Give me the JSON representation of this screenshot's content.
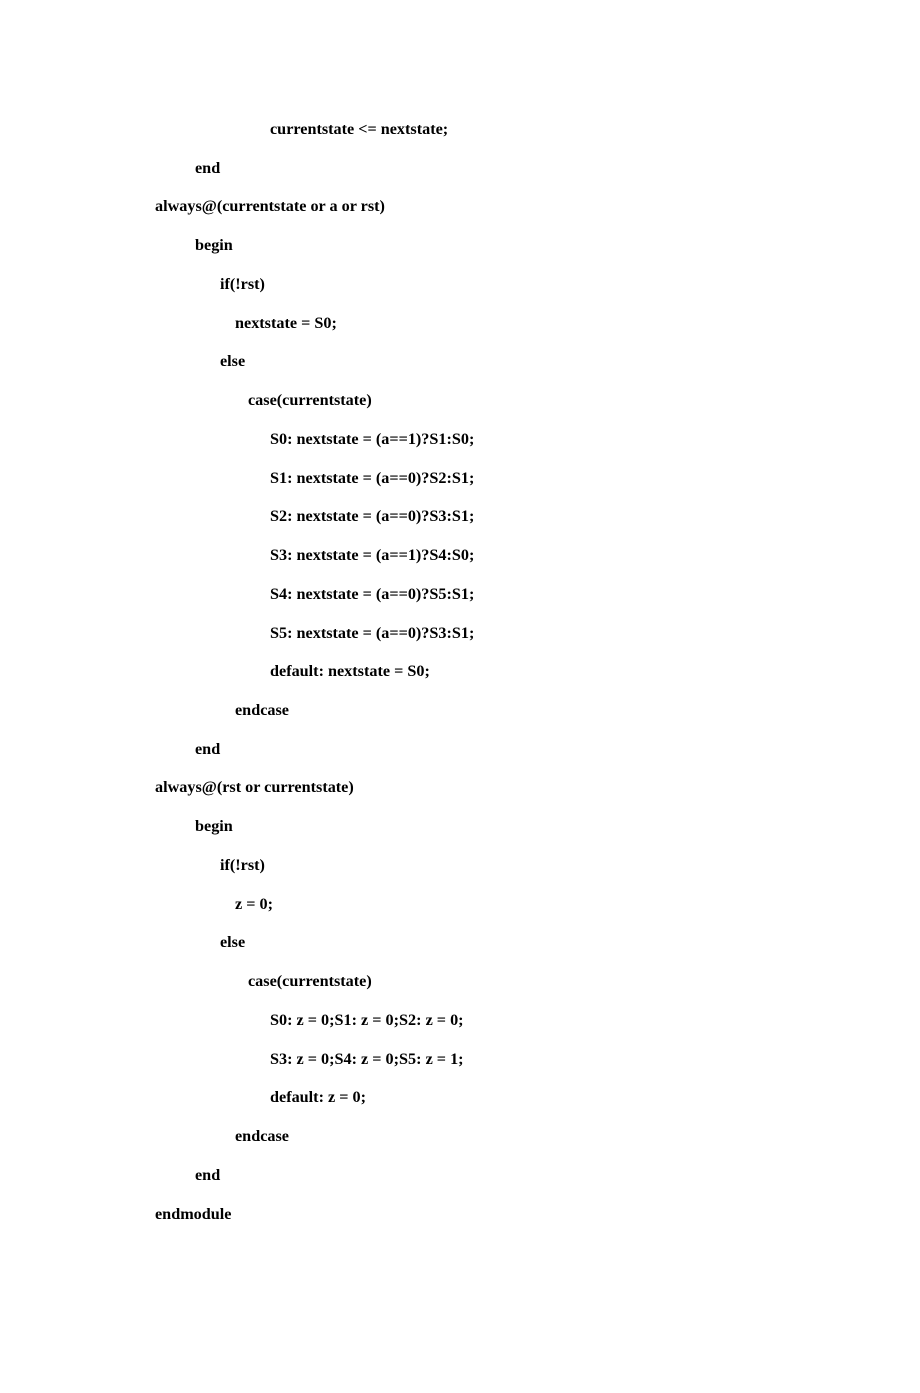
{
  "lines": [
    {
      "cls": "indent-4",
      "text": "currentstate <= nextstate;"
    },
    {
      "cls": "indent-1",
      "text": "end"
    },
    {
      "cls": "indent-0",
      "text": "always@(currentstate or a or rst)"
    },
    {
      "cls": "indent-1",
      "text": "begin"
    },
    {
      "cls": "indent-2",
      "text": "if(!rst)"
    },
    {
      "cls": "indent-2b",
      "text": "nextstate = S0;"
    },
    {
      "cls": "indent-2",
      "text": "else"
    },
    {
      "cls": "indent-3",
      "text": "case(currentstate)"
    },
    {
      "cls": "indent-4",
      "text": "S0: nextstate = (a==1)?S1:S0;"
    },
    {
      "cls": "indent-4",
      "text": "S1: nextstate = (a==0)?S2:S1;"
    },
    {
      "cls": "indent-4",
      "text": "S2: nextstate = (a==0)?S3:S1;"
    },
    {
      "cls": "indent-4",
      "text": "S3: nextstate = (a==1)?S4:S0;"
    },
    {
      "cls": "indent-4",
      "text": "S4: nextstate = (a==0)?S5:S1;"
    },
    {
      "cls": "indent-4",
      "text": "S5: nextstate = (a==0)?S3:S1;"
    },
    {
      "cls": "indent-4",
      "text": "default: nextstate = S0;"
    },
    {
      "cls": "indent-2b",
      "text": "endcase"
    },
    {
      "cls": "indent-1",
      "text": "end"
    },
    {
      "cls": "indent-0",
      "text": "always@(rst or currentstate)"
    },
    {
      "cls": "indent-1",
      "text": "begin"
    },
    {
      "cls": "indent-2",
      "text": "if(!rst)"
    },
    {
      "cls": "indent-2b",
      "text": "z = 0;"
    },
    {
      "cls": "indent-2",
      "text": "else"
    },
    {
      "cls": "indent-3",
      "text": "case(currentstate)"
    },
    {
      "cls": "indent-3b",
      "text": "S0: z = 0;S1: z = 0;S2: z = 0;"
    },
    {
      "cls": "indent-3b",
      "text": "S3: z = 0;S4: z = 0;S5: z = 1;"
    },
    {
      "cls": "indent-3b",
      "text": "default: z = 0;"
    },
    {
      "cls": "indent-2b",
      "text": "endcase"
    },
    {
      "cls": "indent-1",
      "text": "end"
    },
    {
      "cls": "indent-0",
      "text": "endmodule"
    }
  ]
}
